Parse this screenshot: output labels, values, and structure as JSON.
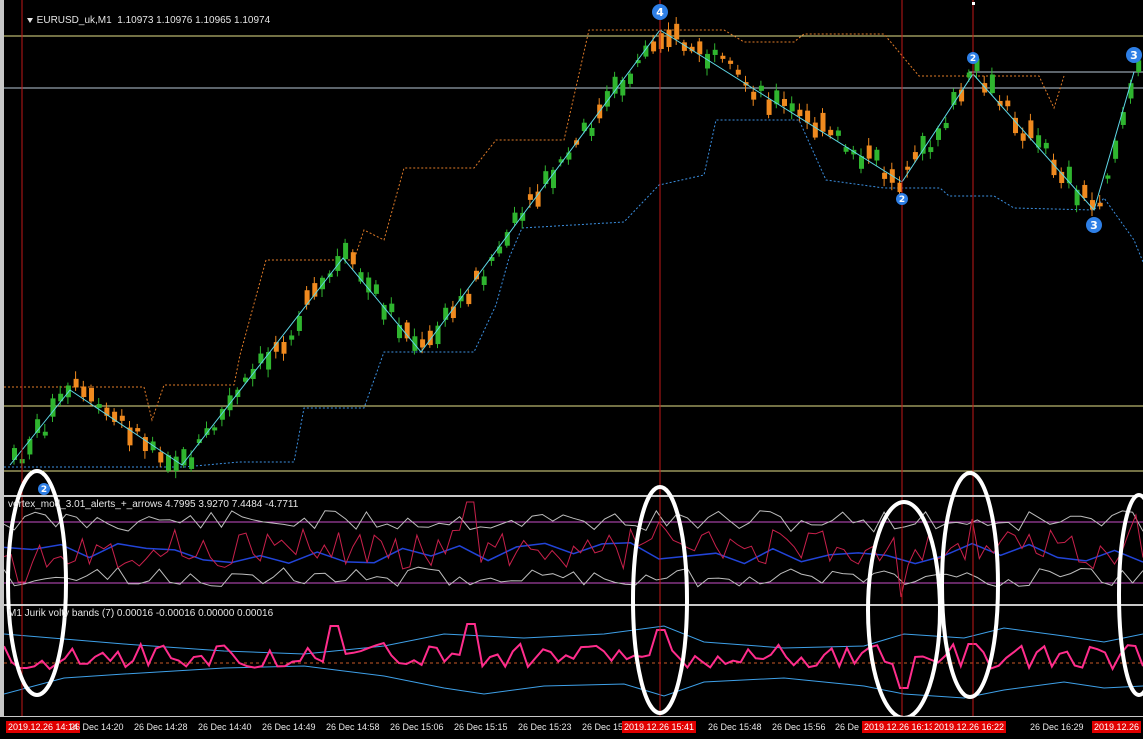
{
  "colors": {
    "background": "#000000",
    "bull": "#2fb52f",
    "bear": "#f08a1f",
    "zigzag": "#5fd8e8",
    "upper_channel": "#e07b28",
    "lower_channel": "#3b8fe0",
    "level_line": "#e6e28a",
    "level_line_2": "#b9c7d6",
    "vertical_marker": "#c01818",
    "circle_annotation": "#ffffff",
    "wave_label": "#2e7fe6",
    "vertex_main": "#c8204b",
    "vertex_signal": "#2244d8",
    "vertex_band": "#bdbdbd",
    "vertex_level": "#c850c8",
    "jurik_main": "#ff2d8c",
    "jurik_band": "#3ea0e8",
    "jurik_zero": "#c85a28"
  },
  "main_pane": {
    "label": "EURUSD_uk,M1  1.10973 1.10976 1.10965 1.10974",
    "wave_labels": [
      {
        "text": "2",
        "kind": "small"
      },
      {
        "text": "4",
        "kind": "big"
      },
      {
        "text": "2",
        "kind": "small"
      },
      {
        "text": "2",
        "kind": "small"
      },
      {
        "text": "3",
        "kind": "big"
      },
      {
        "text": "3",
        "kind": "big"
      }
    ]
  },
  "vertex_pane": {
    "label": "vertex_mod_3.01_alerts_+_arrows 4.7995 3.9270 7.4484 -4.7711"
  },
  "jurik_pane": {
    "label": "M1 Jurik volty bands (7) 0.00016 -0.00016 0.00000 0.00016"
  },
  "time_axis": {
    "ticks": [
      {
        "label": "2019.12.26 14:14",
        "highlight": true
      },
      {
        "label": "26 Dec 14:20",
        "highlight": false
      },
      {
        "label": "26 Dec 14:28",
        "highlight": false
      },
      {
        "label": "26 Dec 14:40",
        "highlight": false
      },
      {
        "label": "26 Dec 14:49",
        "highlight": false
      },
      {
        "label": "26 Dec 14:58",
        "highlight": false
      },
      {
        "label": "26 Dec 15:06",
        "highlight": false
      },
      {
        "label": "26 Dec 15:15",
        "highlight": false
      },
      {
        "label": "26 Dec 15:23",
        "highlight": false
      },
      {
        "label": "26 Dec 15:",
        "highlight": false
      },
      {
        "label": "2019.12.26 15:41",
        "highlight": true
      },
      {
        "label": "26 Dec 15:48",
        "highlight": false
      },
      {
        "label": "26 Dec 15:56",
        "highlight": false
      },
      {
        "label": "26 De",
        "highlight": false
      },
      {
        "label": "2019.12.26 16:13",
        "highlight": true
      },
      {
        "label": "2019.12.26 16:22",
        "highlight": true
      },
      {
        "label": "26 Dec 16:29",
        "highlight": false
      },
      {
        "label": "2019.12.26",
        "highlight": true
      }
    ]
  },
  "chart_data": {
    "type": "line",
    "symbol": "EURUSD_uk",
    "timeframe": "M1",
    "ohlc_readout": [
      1.10973,
      1.10976,
      1.10965,
      1.10974
    ],
    "grid": false,
    "zigzag_pivots": [
      {
        "time": "14:14",
        "kind": "low"
      },
      {
        "time": "14:18",
        "kind": "high"
      },
      {
        "time": "14:27",
        "kind": "low"
      },
      {
        "time": "14:59",
        "kind": "high"
      },
      {
        "time": "15:08",
        "kind": "low"
      },
      {
        "time": "15:41",
        "kind": "high",
        "wave": "4"
      },
      {
        "time": "16:13",
        "kind": "low",
        "wave": "2"
      },
      {
        "time": "16:22",
        "kind": "high",
        "wave": "2"
      },
      {
        "time": "16:39",
        "kind": "low",
        "wave": "3"
      },
      {
        "time": "16:44",
        "kind": "high",
        "wave": "3"
      }
    ],
    "vertical_markers": [
      "15:41",
      "16:13",
      "16:22"
    ],
    "vertex_values": {
      "main": 4.7995,
      "signal": 3.927,
      "upper": 7.4484,
      "lower": -4.7711
    },
    "jurik_values": {
      "upper": 0.00016,
      "lower": -0.00016,
      "zero": 0.0,
      "main": 0.00016,
      "period": 7
    }
  }
}
